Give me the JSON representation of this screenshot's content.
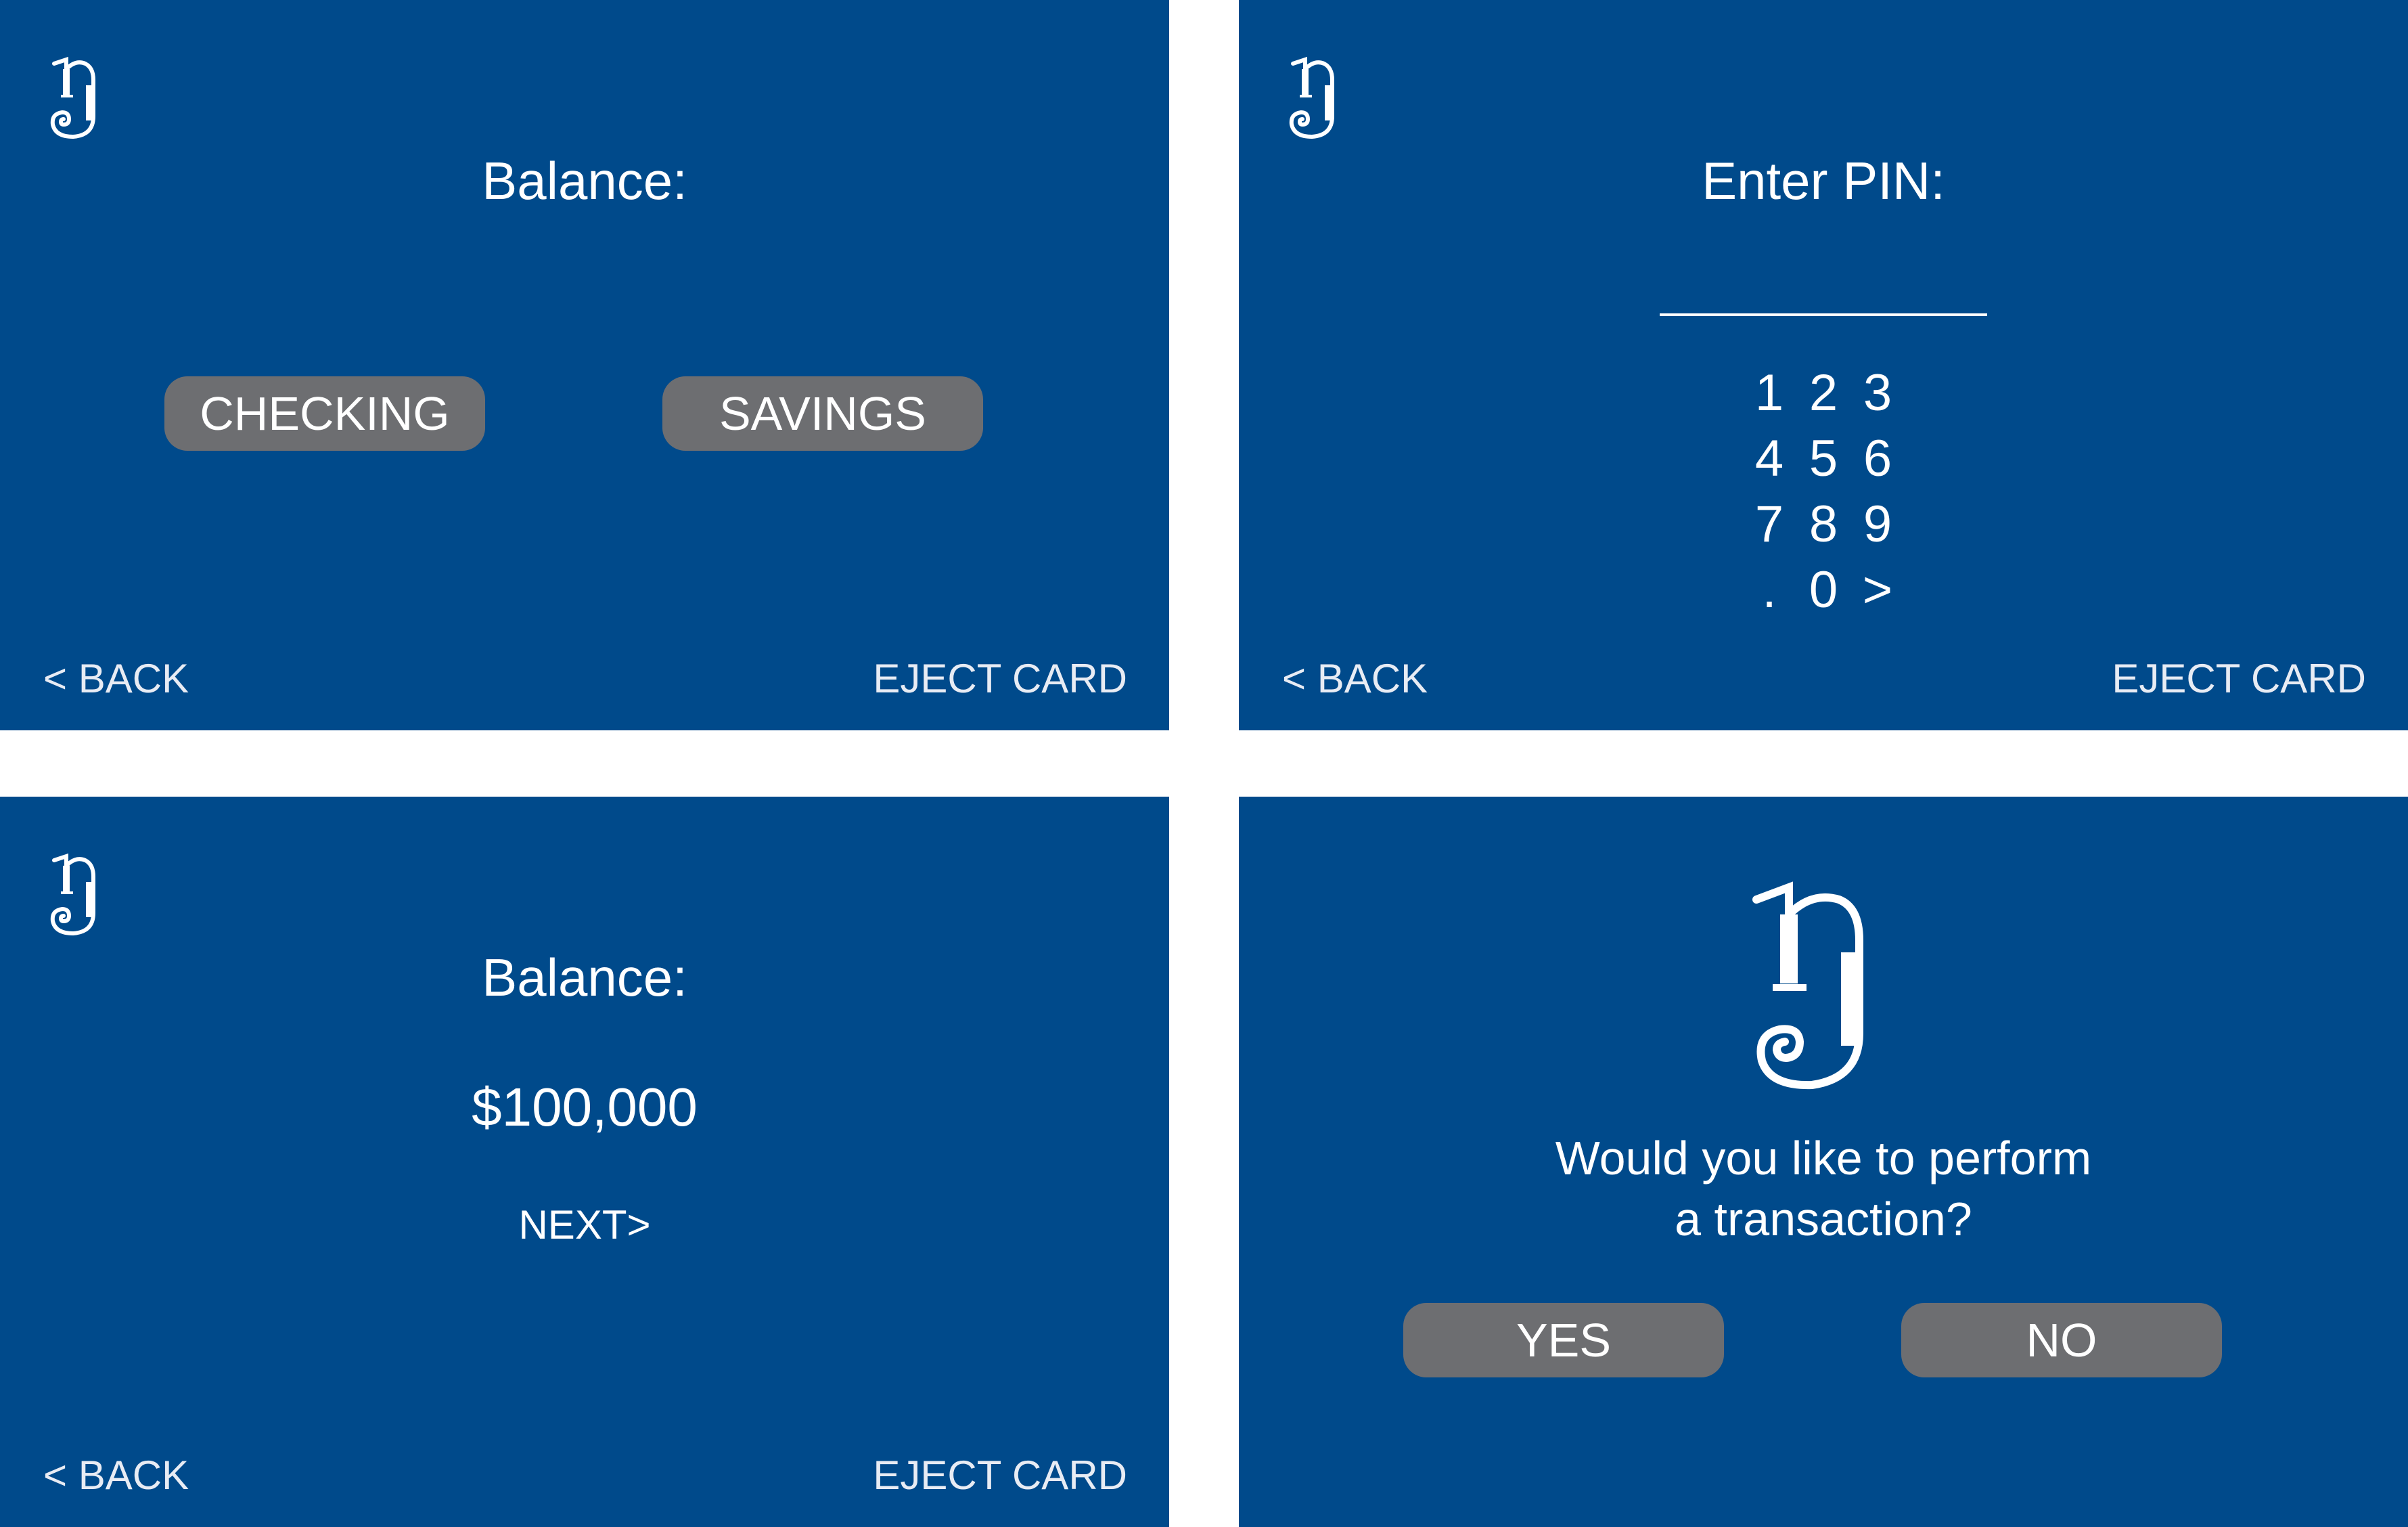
{
  "screens": {
    "balance_select": {
      "heading": "Balance:",
      "checking_label": "CHECKING",
      "savings_label": "SAVINGS",
      "back_label": "< BACK",
      "eject_label": "EJECT CARD"
    },
    "pin_entry": {
      "heading": "Enter PIN:",
      "keys": [
        "1",
        "2",
        "3",
        "4",
        "5",
        "6",
        "7",
        "8",
        "9",
        ".",
        "0",
        ">"
      ],
      "back_label": "< BACK",
      "eject_label": "EJECT CARD"
    },
    "balance_display": {
      "heading": "Balance:",
      "amount": "$100,000",
      "next_label": "NEXT>",
      "back_label": "< BACK",
      "eject_label": "EJECT CARD"
    },
    "transaction_prompt": {
      "question_line1": "Would you like to perform",
      "question_line2": "a transaction?",
      "yes_label": "YES",
      "no_label": "NO"
    }
  },
  "colors": {
    "screen_background": "#004a8b",
    "button_gray": "#6d6e71",
    "text": "#ffffff"
  },
  "icons": {
    "logo": "bank-monogram-logo-icon"
  }
}
